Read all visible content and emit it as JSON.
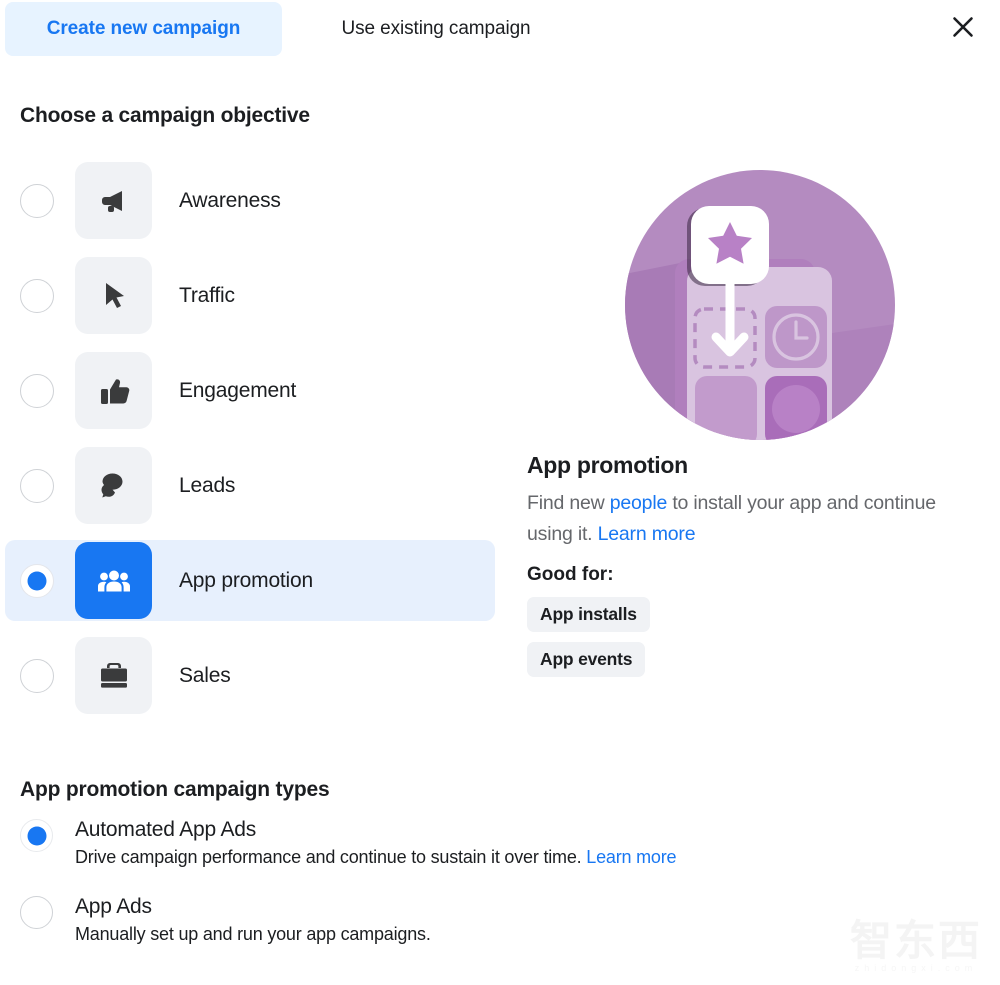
{
  "tabs": [
    {
      "label": "Create new campaign",
      "active": true
    },
    {
      "label": "Use existing campaign",
      "active": false
    }
  ],
  "close_icon": "close-icon",
  "objective_section": {
    "title": "Choose a campaign objective",
    "items": [
      {
        "label": "Awareness",
        "icon": "megaphone-icon",
        "selected": false
      },
      {
        "label": "Traffic",
        "icon": "cursor-icon",
        "selected": false
      },
      {
        "label": "Engagement",
        "icon": "thumbs-up-icon",
        "selected": false
      },
      {
        "label": "Leads",
        "icon": "chat-bubbles-icon",
        "selected": false
      },
      {
        "label": "App promotion",
        "icon": "people-icon",
        "selected": true
      },
      {
        "label": "Sales",
        "icon": "briefcase-icon",
        "selected": false
      }
    ]
  },
  "info_panel": {
    "illustration": "app-promotion-illustration",
    "title": "App promotion",
    "desc_part1": "Find new ",
    "desc_link1": "people",
    "desc_part2": " to install your app and continue using it. ",
    "desc_link2": "Learn more",
    "good_for_label": "Good for:",
    "badges": [
      "App installs",
      "App events"
    ]
  },
  "campaign_types": {
    "title": "App promotion campaign types",
    "options": [
      {
        "label": "Automated App Ads",
        "desc": "Drive campaign performance and continue to sustain it over time. ",
        "link": "Learn more",
        "selected": true
      },
      {
        "label": "App Ads",
        "desc": "Manually set up and run your app campaigns.",
        "link": "",
        "selected": false
      }
    ]
  },
  "watermark": {
    "text": "智东西",
    "sub": "zhidongxi.com"
  },
  "colors": {
    "accent_blue": "#1877F2",
    "tab_active_bg": "#E7F3FF",
    "row_selected_bg": "#E7F0FD",
    "tile_bg": "#F0F2F5",
    "muted_text": "#65676B",
    "illustration_purple": "#B48BC0"
  }
}
